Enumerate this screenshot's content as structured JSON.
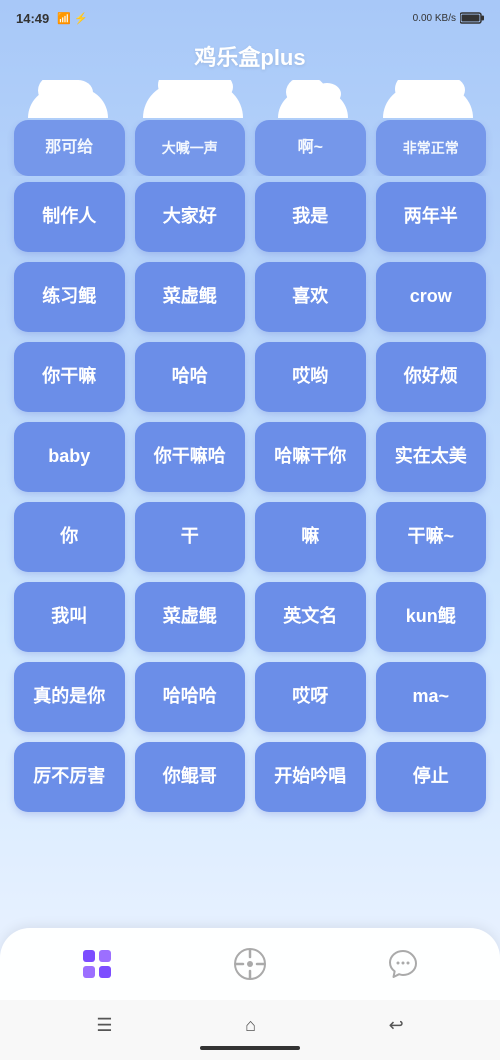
{
  "statusBar": {
    "time": "14:49",
    "networkSpeed": "0.00 KB/s",
    "battery": "98"
  },
  "header": {
    "title": "鸡乐盒plus"
  },
  "topPartialRow": [
    {
      "id": "top1",
      "label": "那可给"
    },
    {
      "id": "top2",
      "label": "大喊一声"
    },
    {
      "id": "top3",
      "label": "啊~"
    },
    {
      "id": "top4",
      "label": "非常正常"
    }
  ],
  "gridButtons": [
    {
      "id": "btn1",
      "label": "制作人"
    },
    {
      "id": "btn2",
      "label": "大家好"
    },
    {
      "id": "btn3",
      "label": "我是"
    },
    {
      "id": "btn4",
      "label": "两年半"
    },
    {
      "id": "btn5",
      "label": "练习鲲"
    },
    {
      "id": "btn6",
      "label": "菜虚鲲"
    },
    {
      "id": "btn7",
      "label": "喜欢"
    },
    {
      "id": "btn8",
      "label": "crow"
    },
    {
      "id": "btn9",
      "label": "你干嘛"
    },
    {
      "id": "btn10",
      "label": "哈哈"
    },
    {
      "id": "btn11",
      "label": "哎哟"
    },
    {
      "id": "btn12",
      "label": "你好烦"
    },
    {
      "id": "btn13",
      "label": "baby"
    },
    {
      "id": "btn14",
      "label": "你干嘛哈"
    },
    {
      "id": "btn15",
      "label": "哈嘛干你"
    },
    {
      "id": "btn16",
      "label": "实在太美"
    },
    {
      "id": "btn17",
      "label": "你"
    },
    {
      "id": "btn18",
      "label": "干"
    },
    {
      "id": "btn19",
      "label": "嘛"
    },
    {
      "id": "btn20",
      "label": "干嘛~"
    },
    {
      "id": "btn21",
      "label": "我叫"
    },
    {
      "id": "btn22",
      "label": "菜虚鲲"
    },
    {
      "id": "btn23",
      "label": "英文名"
    },
    {
      "id": "btn24",
      "label": "kun鲲"
    },
    {
      "id": "btn25",
      "label": "真的是你"
    },
    {
      "id": "btn26",
      "label": "哈哈哈"
    },
    {
      "id": "btn27",
      "label": "哎呀"
    },
    {
      "id": "btn28",
      "label": "ma~"
    },
    {
      "id": "btn29",
      "label": "厉不厉害"
    },
    {
      "id": "btn30",
      "label": "你鲲哥"
    },
    {
      "id": "btn31",
      "label": "开始吟唱"
    },
    {
      "id": "btn32",
      "label": "停止"
    }
  ],
  "bottomNav": {
    "items": [
      {
        "id": "nav1",
        "icon": "grid-icon",
        "active": true
      },
      {
        "id": "nav2",
        "icon": "compass-icon",
        "active": false
      },
      {
        "id": "nav3",
        "icon": "chat-icon",
        "active": false
      }
    ]
  },
  "homeBar": {
    "buttons": [
      "menu-button",
      "home-button",
      "back-button"
    ]
  }
}
